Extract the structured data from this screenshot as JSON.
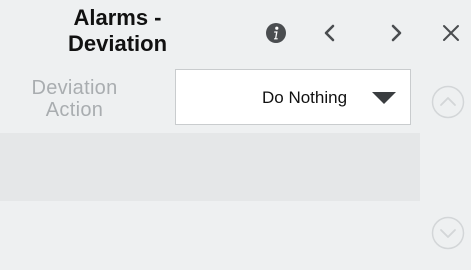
{
  "header": {
    "title": "Alarms - Deviation",
    "info_icon": "info-icon",
    "prev_icon": "chevron-left-icon",
    "next_icon": "chevron-right-icon",
    "close_icon": "close-icon"
  },
  "fields": [
    {
      "label": "Deviation Action",
      "value": "Do Nothing",
      "control": "dropdown"
    }
  ],
  "scroll": {
    "up_icon": "chevron-up-circle-icon",
    "down_icon": "chevron-down-circle-icon"
  },
  "colors": {
    "background": "#eef0f1",
    "row_alt": "#e5e7e8",
    "label_disabled": "#a9adb0",
    "icon": "#4a4d50",
    "scroll_icon": "#d3d6d8"
  }
}
